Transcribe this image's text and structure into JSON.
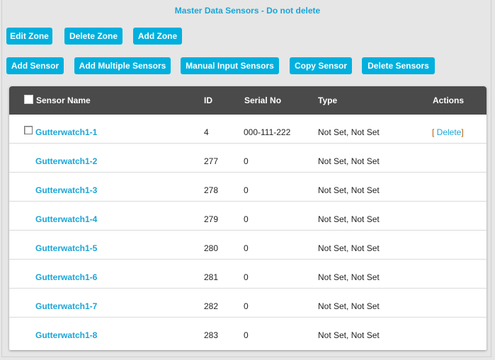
{
  "title": "Master Data Sensors - Do not delete",
  "zone_buttons": [
    {
      "label": "Edit Zone"
    },
    {
      "label": "Delete Zone"
    },
    {
      "label": "Add Zone"
    }
  ],
  "sensor_buttons": [
    {
      "label": "Add Sensor"
    },
    {
      "label": "Add Multiple Sensors"
    },
    {
      "label": "Manual Input Sensors"
    },
    {
      "label": "Copy Sensor"
    },
    {
      "label": "Delete Sensors"
    }
  ],
  "table": {
    "columns": [
      "Sensor Name",
      "ID",
      "Serial No",
      "Type",
      "Actions"
    ],
    "rows": [
      {
        "name": "Gutterwatch1-1",
        "id": "4",
        "serial": "000-111-222",
        "type": "Not Set, Not Set",
        "has_checkbox": true,
        "action_open": "[ ",
        "action": "Delete",
        "action_close": "]"
      },
      {
        "name": "Gutterwatch1-2",
        "id": "277",
        "serial": "0",
        "type": "Not Set, Not Set"
      },
      {
        "name": "Gutterwatch1-3",
        "id": "278",
        "serial": "0",
        "type": "Not Set, Not Set"
      },
      {
        "name": "Gutterwatch1-4",
        "id": "279",
        "serial": "0",
        "type": "Not Set, Not Set"
      },
      {
        "name": "Gutterwatch1-5",
        "id": "280",
        "serial": "0",
        "type": "Not Set, Not Set"
      },
      {
        "name": "Gutterwatch1-6",
        "id": "281",
        "serial": "0",
        "type": "Not Set, Not Set"
      },
      {
        "name": "Gutterwatch1-7",
        "id": "282",
        "serial": "0",
        "type": "Not Set, Not Set"
      },
      {
        "name": "Gutterwatch1-8",
        "id": "283",
        "serial": "0",
        "type": "Not Set, Not Set"
      }
    ]
  },
  "colors": {
    "accent": "#00b0de",
    "link": "#1aa5d6",
    "header_bg": "#4a4a4a",
    "bracket": "#b25e00"
  }
}
